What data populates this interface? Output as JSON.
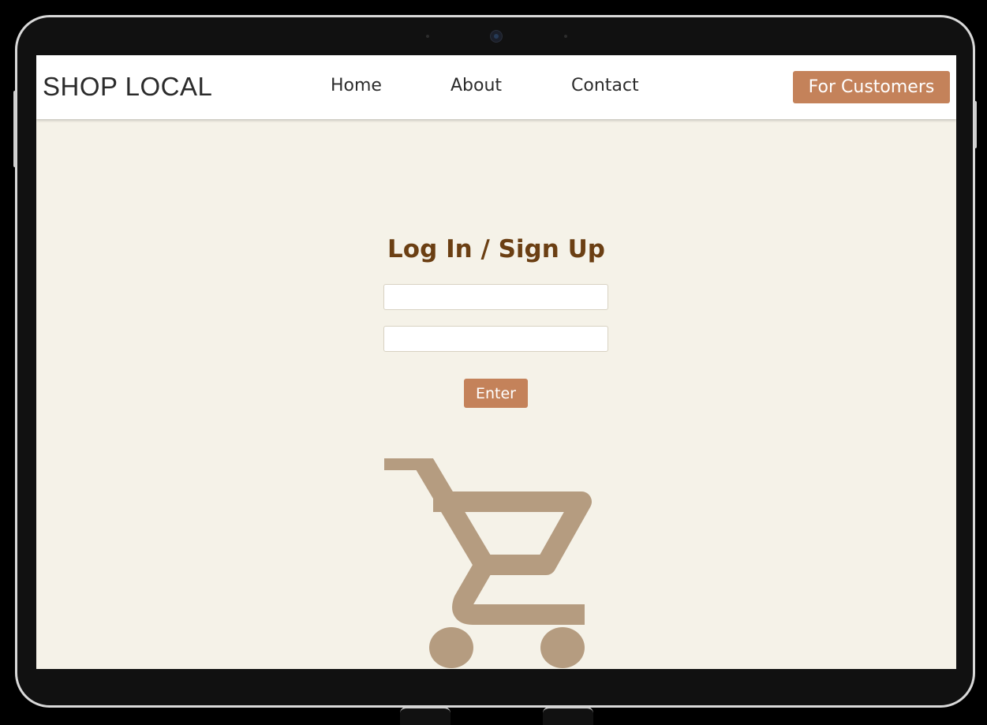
{
  "nav": {
    "brand": "SHOP LOCAL",
    "links": [
      {
        "label": "Home"
      },
      {
        "label": "About"
      },
      {
        "label": "Contact"
      }
    ],
    "cta_label": "For Customers"
  },
  "login": {
    "title": "Log In / Sign Up",
    "username": {
      "value": "",
      "placeholder": ""
    },
    "password": {
      "value": "",
      "placeholder": ""
    },
    "submit_label": "Enter"
  },
  "illustration": {
    "icon": "shopping-cart-icon"
  },
  "colors": {
    "accent": "#c4825a",
    "heading": "#6b3f13",
    "background": "#f5f2e8",
    "cart_icon": "#b59c80",
    "navbar": "#ffffff",
    "device_frame": "#111111"
  }
}
